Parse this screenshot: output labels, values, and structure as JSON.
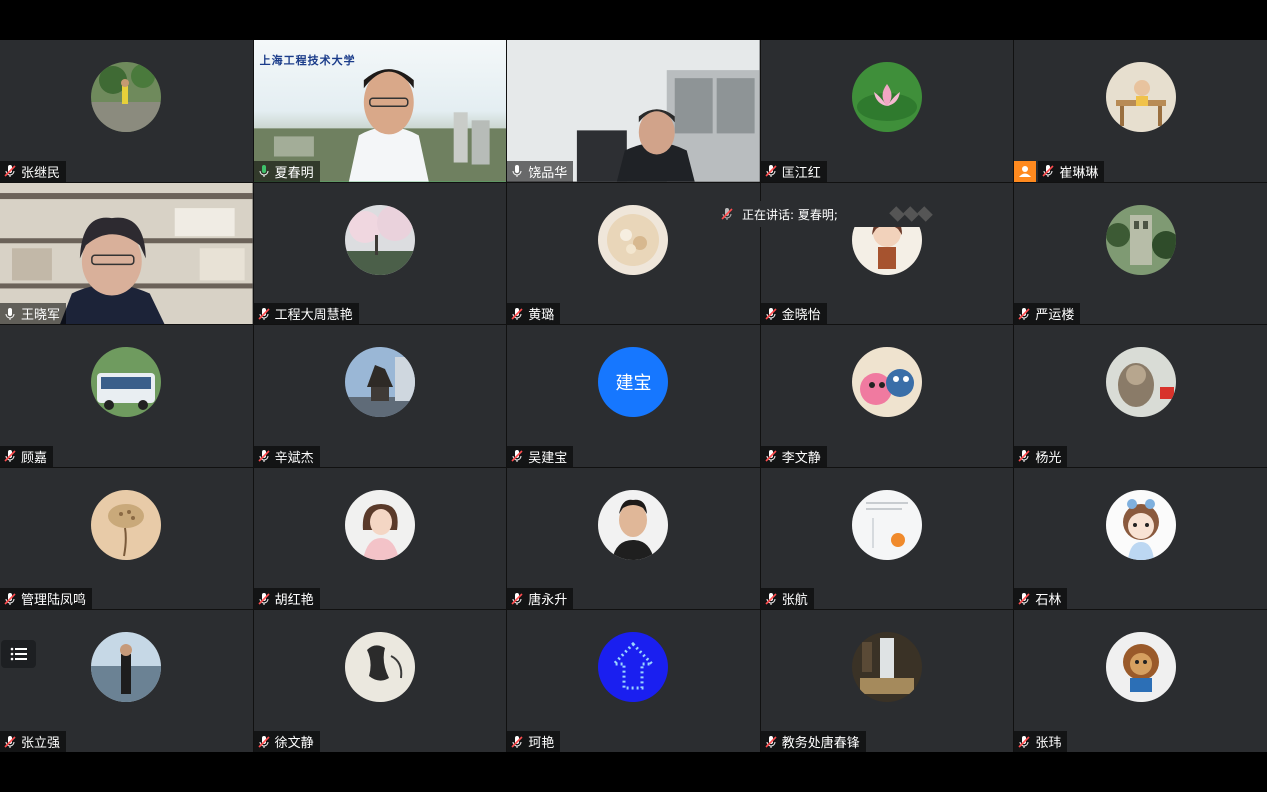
{
  "participants": [
    {
      "name": "张继民",
      "mic": "muted",
      "avatar": "photo-runner"
    },
    {
      "name": "夏春明",
      "mic": "speaking",
      "video": "camera-university",
      "logo_text": "上海工程技术大学"
    },
    {
      "name": "饶品华",
      "mic": "on",
      "video": "camera-office"
    },
    {
      "name": "匡江红",
      "mic": "muted",
      "avatar": "photo-lotus"
    },
    {
      "name": "崔琳琳",
      "mic": "muted",
      "avatar": "photo-child-desk",
      "badge": "host"
    },
    {
      "name": "王晓军",
      "mic": "on",
      "video": "camera-bookshelf"
    },
    {
      "name": "工程大周慧艳",
      "mic": "muted",
      "avatar": "photo-blossom"
    },
    {
      "name": "黄璐",
      "mic": "muted",
      "avatar": "photo-food"
    },
    {
      "name": "金晓怡",
      "mic": "muted",
      "avatar": "photo-cartoon-girl"
    },
    {
      "name": "严运楼",
      "mic": "muted",
      "avatar": "photo-building"
    },
    {
      "name": "顾嘉",
      "mic": "muted",
      "avatar": "photo-bus"
    },
    {
      "name": "辛斌杰",
      "mic": "muted",
      "avatar": "photo-statue"
    },
    {
      "name": "吴建宝",
      "mic": "muted",
      "avatar_text": "建宝"
    },
    {
      "name": "李文静",
      "mic": "muted",
      "avatar": "photo-plush"
    },
    {
      "name": "杨光",
      "mic": "muted",
      "avatar": "photo-monkey"
    },
    {
      "name": "管理陆凤鸣",
      "mic": "muted",
      "avatar": "photo-lotus-pod"
    },
    {
      "name": "胡红艳",
      "mic": "muted",
      "avatar": "photo-woman"
    },
    {
      "name": "唐永升",
      "mic": "muted",
      "avatar": "photo-man"
    },
    {
      "name": "张航",
      "mic": "muted",
      "avatar": "photo-snow-bird"
    },
    {
      "name": "石林",
      "mic": "muted",
      "avatar": "photo-cartoon-avatar"
    },
    {
      "name": "张立强",
      "mic": "muted",
      "avatar": "photo-person-river"
    },
    {
      "name": "徐文静",
      "mic": "muted",
      "avatar": "photo-ink-painting"
    },
    {
      "name": "珂艳",
      "mic": "muted",
      "avatar": "photo-blue-arrow"
    },
    {
      "name": "教务处唐春锋",
      "mic": "muted",
      "avatar": "photo-waterfall"
    },
    {
      "name": "张玮",
      "mic": "muted",
      "avatar": "photo-lion-toy"
    }
  ],
  "speaking_indicator": {
    "label": "正在讲话: 夏春明;"
  },
  "colors": {
    "tile_bg": "#2b2d30",
    "avatar_blue": "#1677ff",
    "host_badge": "#ff8a1f",
    "speaking_green": "#3fc26b"
  }
}
